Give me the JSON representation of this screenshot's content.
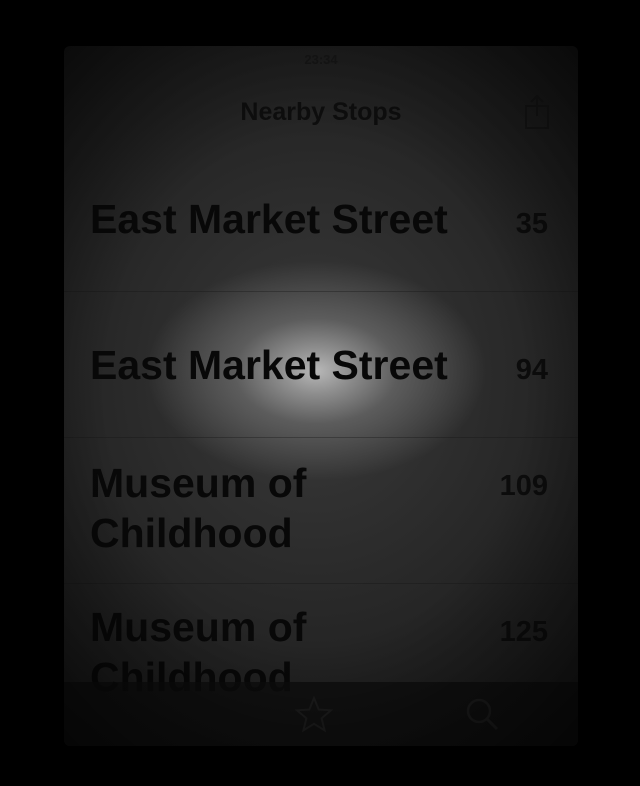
{
  "status_bar": {
    "carrier": "",
    "time": "23:34",
    "battery": ""
  },
  "nav": {
    "title": "Nearby Stops",
    "share_icon": "share-icon"
  },
  "stops": [
    {
      "name": "East Market Street",
      "number": "35"
    },
    {
      "name": "East Market Street",
      "number": "94"
    },
    {
      "name": "Museum of Childhood",
      "number": "109"
    },
    {
      "name": "Museum of Childhood",
      "number": "125"
    }
  ],
  "tab_bar": {
    "icons": [
      "star-icon",
      "search-icon"
    ]
  },
  "colors": {
    "screen_background": "#2a2a2a",
    "text": "#080808",
    "highlight": "#b8b8b8"
  }
}
